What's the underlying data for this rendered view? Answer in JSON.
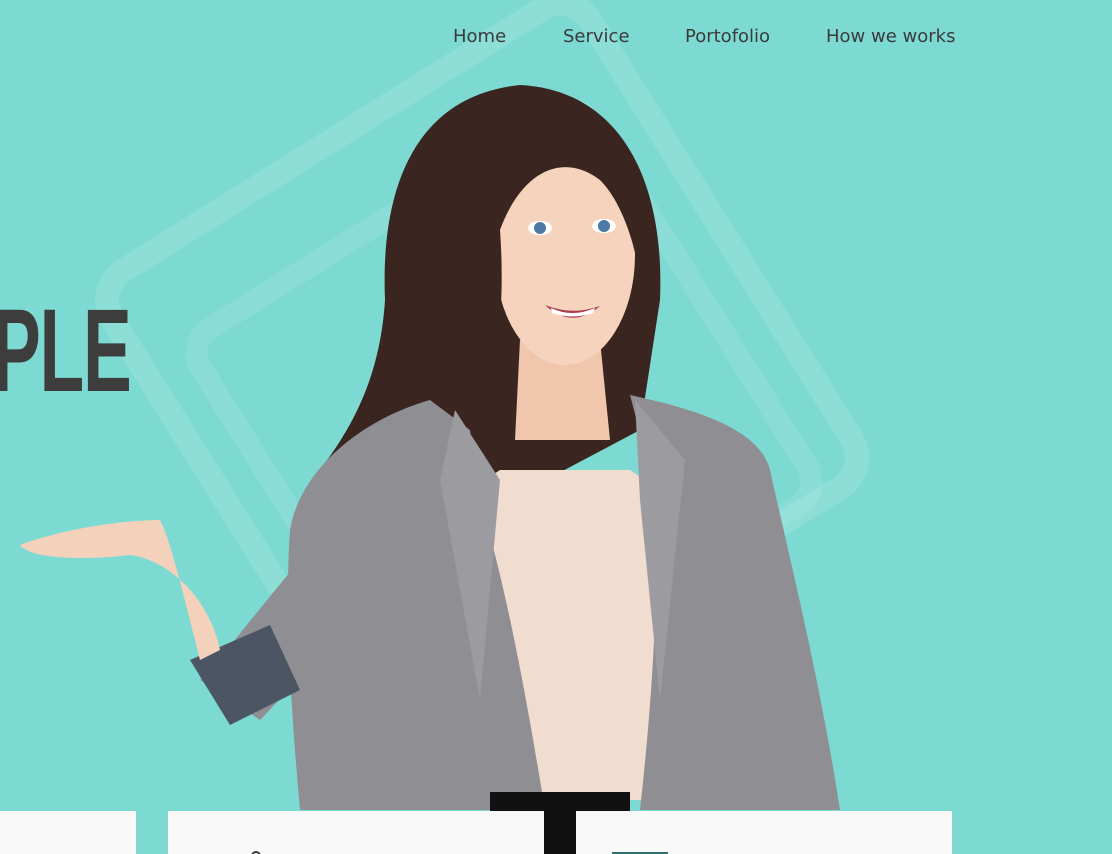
{
  "nav": {
    "items": [
      {
        "label": "Home"
      },
      {
        "label": "Service"
      },
      {
        "label": "Portofolio"
      },
      {
        "label": "How we works"
      }
    ]
  },
  "hero": {
    "headline_fragment": "PLE"
  },
  "colors": {
    "background": "#7ddad2",
    "text": "#3a3a3a",
    "card": "#f8f8f8"
  },
  "icons": {
    "card2": "pin-icon",
    "card3": "tray-icon"
  }
}
